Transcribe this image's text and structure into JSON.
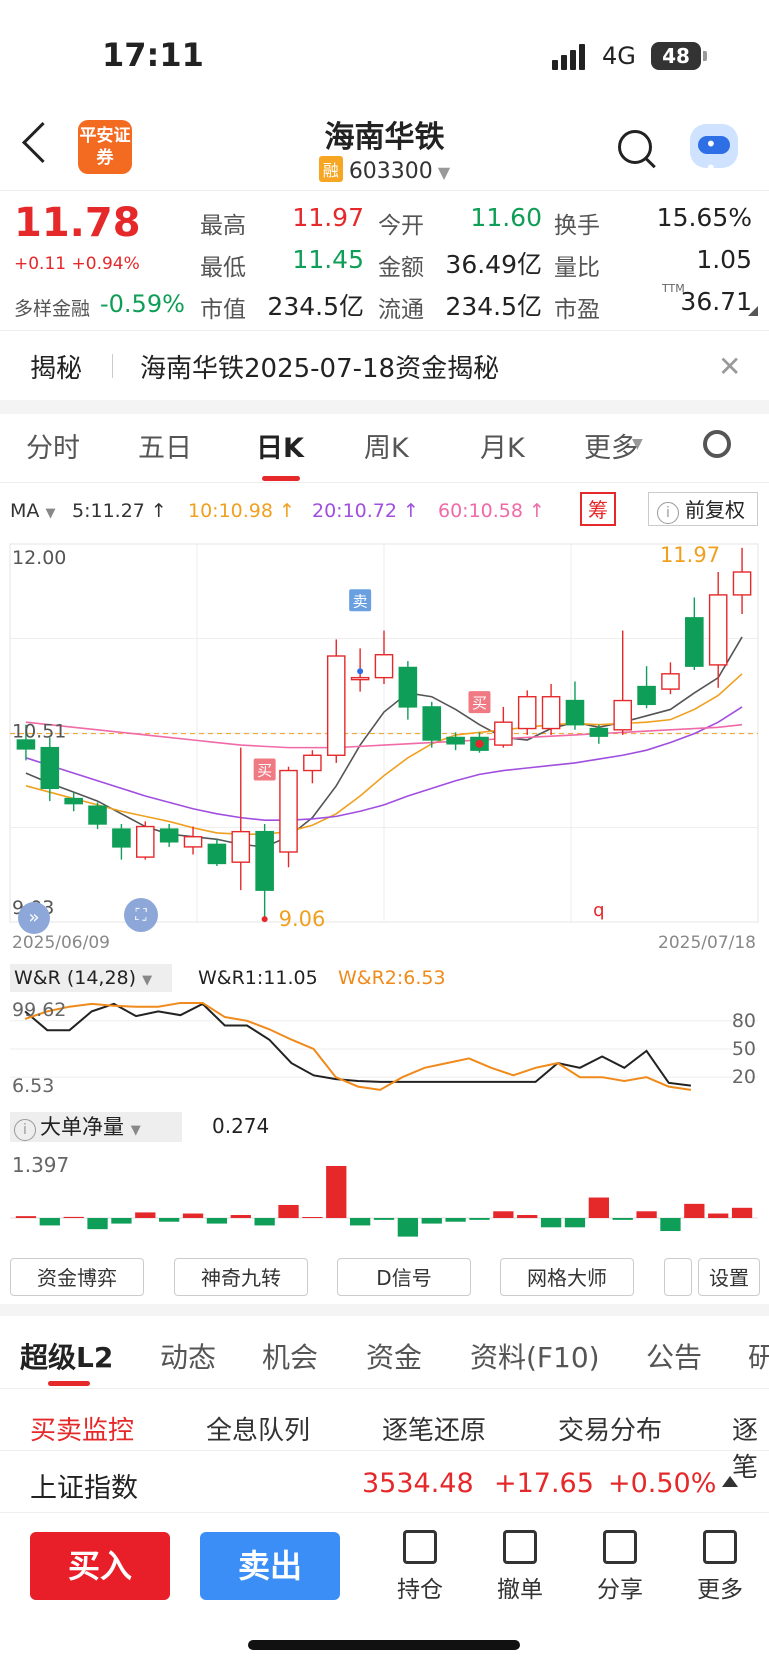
{
  "status": {
    "time": "17:11",
    "network": "4G",
    "battery": "48"
  },
  "header": {
    "logo": "平安证券",
    "title": "海南华铁",
    "badge": "融",
    "code": "603300",
    "icons": [
      "back-icon",
      "search-icon",
      "robot-assistant-icon"
    ]
  },
  "quote": {
    "price": "11.78",
    "change": "+0.11",
    "change_pct": "+0.94%",
    "diversified_label": "多样金融",
    "diversified_value": "-0.59%",
    "fields": [
      {
        "label": "最高",
        "value": "11.97",
        "color": "#e5282a"
      },
      {
        "label": "今开",
        "value": "11.60",
        "color": "#0f9e57"
      },
      {
        "label": "换手",
        "value": "15.65%",
        "color": "#222222"
      },
      {
        "label": "最低",
        "value": "11.45",
        "color": "#0f9e57"
      },
      {
        "label": "金额",
        "value": "36.49亿",
        "color": "#222222"
      },
      {
        "label": "量比",
        "value": "1.05",
        "color": "#222222"
      },
      {
        "label": "市值",
        "value": "234.5亿",
        "color": "#222222"
      },
      {
        "label": "流通",
        "value": "234.5亿",
        "color": "#222222"
      },
      {
        "label": "市盈",
        "value": "36.71",
        "color": "#222222"
      }
    ],
    "ttm": "TTM"
  },
  "banner": {
    "label": "揭秘",
    "text": "海南华铁2025-07-18资金揭秘"
  },
  "ktabs": [
    "分时",
    "五日",
    "日K",
    "周K",
    "月K",
    "更多"
  ],
  "ma": {
    "label": "MA",
    "items": [
      {
        "text": "5:11.27 ↑",
        "color": "#333333"
      },
      {
        "text": "10:10.98 ↑",
        "color": "#f0a020"
      },
      {
        "text": "20:10.72 ↑",
        "color": "#a04ee0"
      },
      {
        "text": "60:10.58 ↑",
        "color": "#f06aa8"
      }
    ],
    "chou": "筹",
    "fuquan": "前复权"
  },
  "chart_data": [
    {
      "type": "candlestick",
      "y_ticks": [
        "12.00",
        "10.51",
        "9.03"
      ],
      "ylim": [
        9.03,
        12.0
      ],
      "date_start": "2025/06/09",
      "date_end": "2025/07/18",
      "high_label": "11.97",
      "low_label": "9.06",
      "marker_buy": "买",
      "marker_sell": "卖",
      "marker_q": "q",
      "candles": [
        {
          "o": 10.46,
          "c": 10.39,
          "h": 10.58,
          "l": 10.3
        },
        {
          "o": 10.4,
          "c": 10.08,
          "h": 10.48,
          "l": 9.98
        },
        {
          "o": 10.0,
          "c": 9.96,
          "h": 10.05,
          "l": 9.9
        },
        {
          "o": 9.94,
          "c": 9.8,
          "h": 9.97,
          "l": 9.76
        },
        {
          "o": 9.76,
          "c": 9.62,
          "h": 9.8,
          "l": 9.52
        },
        {
          "o": 9.54,
          "c": 9.78,
          "h": 9.82,
          "l": 9.52
        },
        {
          "o": 9.76,
          "c": 9.66,
          "h": 9.8,
          "l": 9.62
        },
        {
          "o": 9.62,
          "c": 9.7,
          "h": 9.78,
          "l": 9.56
        },
        {
          "o": 9.64,
          "c": 9.49,
          "h": 9.68,
          "l": 9.47
        },
        {
          "o": 9.5,
          "c": 9.74,
          "h": 10.4,
          "l": 9.28
        },
        {
          "o": 9.74,
          "c": 9.28,
          "h": 9.8,
          "l": 9.06
        },
        {
          "o": 9.58,
          "c": 10.22,
          "h": 10.25,
          "l": 9.46
        },
        {
          "o": 10.22,
          "c": 10.34,
          "h": 10.38,
          "l": 10.12
        },
        {
          "o": 10.34,
          "c": 11.12,
          "h": 11.25,
          "l": 10.28
        },
        {
          "o": 10.95,
          "c": 10.95,
          "h": 11.18,
          "l": 10.84
        },
        {
          "o": 10.95,
          "c": 11.13,
          "h": 11.32,
          "l": 10.9
        },
        {
          "o": 11.03,
          "c": 10.72,
          "h": 11.08,
          "l": 10.62
        },
        {
          "o": 10.72,
          "c": 10.46,
          "h": 10.76,
          "l": 10.4
        },
        {
          "o": 10.48,
          "c": 10.43,
          "h": 10.52,
          "l": 10.38
        },
        {
          "o": 10.48,
          "c": 10.38,
          "h": 10.52,
          "l": 10.36
        },
        {
          "o": 10.42,
          "c": 10.6,
          "h": 10.72,
          "l": 10.4
        },
        {
          "o": 10.55,
          "c": 10.8,
          "h": 10.85,
          "l": 10.5
        },
        {
          "o": 10.55,
          "c": 10.8,
          "h": 10.9,
          "l": 10.5
        },
        {
          "o": 10.77,
          "c": 10.58,
          "h": 10.92,
          "l": 10.54
        },
        {
          "o": 10.55,
          "c": 10.49,
          "h": 10.58,
          "l": 10.43
        },
        {
          "o": 10.54,
          "c": 10.77,
          "h": 11.32,
          "l": 10.5
        },
        {
          "o": 10.88,
          "c": 10.74,
          "h": 11.04,
          "l": 10.71
        },
        {
          "o": 10.86,
          "c": 10.98,
          "h": 11.07,
          "l": 10.82
        },
        {
          "o": 11.42,
          "c": 11.04,
          "h": 11.58,
          "l": 11.01
        },
        {
          "o": 11.05,
          "c": 11.6,
          "h": 11.78,
          "l": 10.87
        },
        {
          "o": 11.6,
          "c": 11.78,
          "h": 11.97,
          "l": 11.45
        }
      ],
      "ma5": [
        10.2,
        10.12,
        10.05,
        9.98,
        9.88,
        9.78,
        9.72,
        9.7,
        9.68,
        9.64,
        9.62,
        9.7,
        9.85,
        10.1,
        10.42,
        10.68,
        10.83,
        10.8,
        10.7,
        10.58,
        10.48,
        10.46,
        10.55,
        10.6,
        10.56,
        10.6,
        10.65,
        10.7,
        10.83,
        10.95,
        11.27
      ],
      "ma10": [
        10.1,
        10.05,
        10.0,
        9.95,
        9.9,
        9.86,
        9.82,
        9.77,
        9.73,
        9.72,
        9.72,
        9.74,
        9.79,
        9.88,
        10.02,
        10.18,
        10.32,
        10.43,
        10.5,
        10.52,
        10.54,
        10.56,
        10.58,
        10.59,
        10.58,
        10.59,
        10.6,
        10.62,
        10.7,
        10.81,
        10.98
      ],
      "ma20": [
        10.32,
        10.26,
        10.2,
        10.14,
        10.08,
        10.02,
        9.97,
        9.92,
        9.88,
        9.85,
        9.83,
        9.83,
        9.84,
        9.86,
        9.9,
        9.95,
        10.02,
        10.08,
        10.14,
        10.19,
        10.22,
        10.24,
        10.26,
        10.28,
        10.31,
        10.34,
        10.38,
        10.44,
        10.51,
        10.6,
        10.72
      ],
      "ma60": [
        10.6,
        10.58,
        10.56,
        10.54,
        10.52,
        10.5,
        10.48,
        10.46,
        10.44,
        10.42,
        10.41,
        10.4,
        10.4,
        10.4,
        10.41,
        10.42,
        10.43,
        10.44,
        10.45,
        10.46,
        10.47,
        10.48,
        10.49,
        10.5,
        10.51,
        10.52,
        10.53,
        10.54,
        10.55,
        10.56,
        10.58
      ]
    },
    {
      "type": "line",
      "header": "W&R (14,28)",
      "series": [
        {
          "name": "W&R1:11.05",
          "values": [
            90,
            70,
            70,
            90,
            98,
            85,
            90,
            86,
            98,
            75,
            75,
            60,
            35,
            22,
            18,
            16,
            15,
            15,
            15,
            15,
            15,
            15,
            15,
            15,
            35,
            30,
            42,
            30,
            48,
            14,
            11.05
          ]
        },
        {
          "name": "W&R2:6.53",
          "values": [
            82,
            90,
            95,
            98,
            96,
            95,
            95,
            99,
            99,
            84,
            80,
            71,
            60,
            50,
            20,
            10,
            6.53,
            20,
            30,
            35,
            40,
            30,
            22,
            30,
            35,
            20,
            20,
            16,
            20,
            10,
            6.53
          ]
        }
      ],
      "y_labels": [
        "99.62",
        "6.53"
      ],
      "right_labels": [
        "80",
        "50",
        "20"
      ],
      "ylim": [
        0,
        100
      ]
    },
    {
      "type": "bar",
      "header": "大单净量",
      "value_label": "0.274",
      "y_label": "1.397",
      "values": [
        0.05,
        -0.2,
        0.03,
        -0.3,
        -0.15,
        0.15,
        -0.1,
        0.12,
        -0.15,
        0.08,
        -0.2,
        0.35,
        0.02,
        1.397,
        -0.2,
        -0.05,
        -0.5,
        -0.15,
        -0.1,
        -0.05,
        0.18,
        0.08,
        -0.25,
        -0.25,
        0.55,
        -0.05,
        0.18,
        -0.35,
        0.38,
        0.12,
        0.274
      ]
    }
  ],
  "tools": [
    "资金博弈",
    "神奇九转",
    "D信号",
    "网格大师",
    "设置"
  ],
  "l2tabs": [
    "超级L2",
    "动态",
    "机会",
    "资金",
    "资料(F10)",
    "公告",
    "研"
  ],
  "subtabs": [
    "买卖监控",
    "全息队列",
    "逐笔还原",
    "交易分布",
    "逐笔"
  ],
  "index": {
    "name": "上证指数",
    "value": "3534.48",
    "change": "+17.65",
    "pct": "+0.50%"
  },
  "bottom": {
    "buy": "买入",
    "sell": "卖出",
    "nav": [
      "持仓",
      "撤单",
      "分享",
      "更多"
    ]
  }
}
